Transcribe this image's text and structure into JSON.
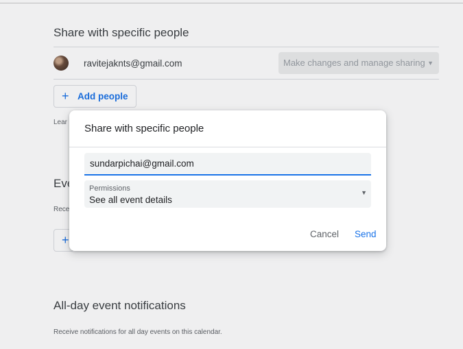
{
  "background": {
    "sections": {
      "share": {
        "title": "Share with specific people",
        "user_email": "ravitejaknts@gmail.com",
        "permission_select": "Make changes and manage sharing",
        "add_people_label": "Add people",
        "learn_truncated": "Lear"
      },
      "event": {
        "title_truncated": "Eve",
        "desc_truncated": "Rece"
      },
      "allday": {
        "title": "All-day event notifications",
        "desc": "Receive notifications for all day events on this calendar."
      }
    }
  },
  "dialog": {
    "title": "Share with specific people",
    "email_value": "sundarpichai@gmail.com",
    "permissions_label": "Permissions",
    "permissions_value": "See all event details",
    "cancel_label": "Cancel",
    "send_label": "Send"
  },
  "colors": {
    "accent": "#1a73e8",
    "text_primary": "#202124",
    "text_secondary": "#5f6368"
  },
  "icons": {
    "add": "plus-icon",
    "dropdown": "caret-down-icon"
  }
}
